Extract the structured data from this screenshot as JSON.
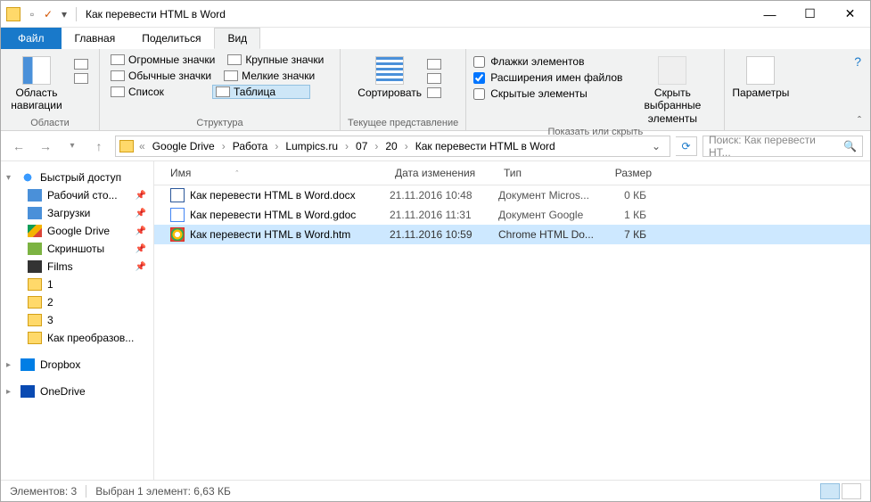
{
  "window": {
    "title": "Как перевести HTML в Word"
  },
  "tabs": {
    "file": "Файл",
    "home": "Главная",
    "share": "Поделиться",
    "view": "Вид"
  },
  "ribbon": {
    "nav": {
      "label": "Область\nнавигации",
      "group": "Области"
    },
    "layout": {
      "huge": "Огромные значки",
      "large": "Крупные значки",
      "normal": "Обычные значки",
      "small": "Мелкие значки",
      "list": "Список",
      "table": "Таблица",
      "group": "Структура"
    },
    "sort": {
      "label": "Сортировать",
      "group": "Текущее представление"
    },
    "show": {
      "chk1": "Флажки элементов",
      "chk2": "Расширения имен файлов",
      "chk3": "Скрытые элементы",
      "hide": "Скрыть выбранные\nэлементы",
      "group": "Показать или скрыть"
    },
    "options": {
      "label": "Параметры"
    }
  },
  "breadcrumb": [
    "Google Drive",
    "Работа",
    "Lumpics.ru",
    "07",
    "20",
    "Как перевести HTML в Word"
  ],
  "search_placeholder": "Поиск: Как перевести HT...",
  "sidebar": {
    "quick": "Быстрый доступ",
    "items": [
      "Рабочий сто...",
      "Загрузки",
      "Google Drive",
      "Скриншоты",
      "Films",
      "1",
      "2",
      "3",
      "Как преобразов..."
    ],
    "dropbox": "Dropbox",
    "onedrive": "OneDrive"
  },
  "columns": {
    "name": "Имя",
    "date": "Дата изменения",
    "type": "Тип",
    "size": "Размер"
  },
  "files": [
    {
      "name": "Как перевести HTML в Word.docx",
      "date": "21.11.2016 10:48",
      "type": "Документ Micros...",
      "size": "0 КБ",
      "ic": "docx"
    },
    {
      "name": "Как перевести HTML в Word.gdoc",
      "date": "21.11.2016 11:31",
      "type": "Документ Google",
      "size": "1 КБ",
      "ic": "gdoc"
    },
    {
      "name": "Как перевести HTML в Word.htm",
      "date": "21.11.2016 10:59",
      "type": "Chrome HTML Do...",
      "size": "7 КБ",
      "ic": "htm",
      "sel": true
    }
  ],
  "status": {
    "count": "Элементов: 3",
    "selected": "Выбран 1 элемент: 6,63 КБ"
  }
}
